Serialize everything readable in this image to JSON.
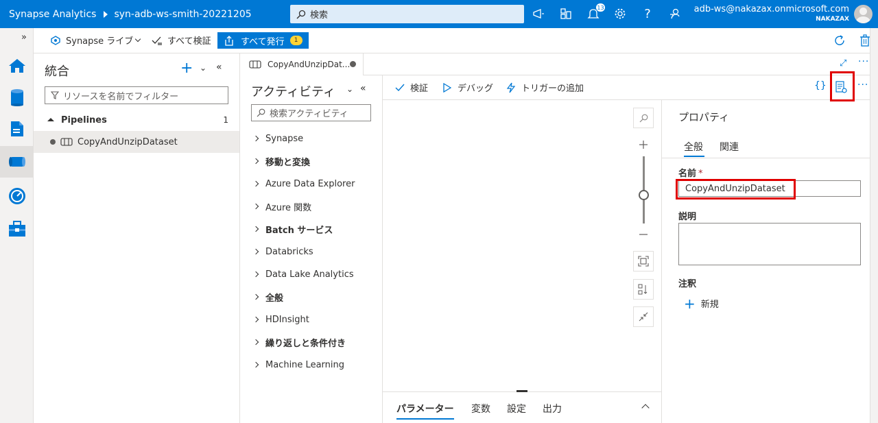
{
  "topbar": {
    "brand": "Synapse Analytics",
    "workspace": "syn-adb-ws-smith-20221205",
    "search_placeholder": "検索",
    "notification_count": "13",
    "user_email": "adb-ws@nakazax.onmicrosoft.com",
    "user_tenant": "NAKAZAX"
  },
  "rail": {
    "expand": "»",
    "items": [
      "home-icon",
      "data-icon",
      "develop-icon",
      "integrate-icon",
      "monitor-icon",
      "manage-icon"
    ]
  },
  "cmdbar": {
    "live_mode": "Synapse ライブ",
    "validate_all": "すべて検証",
    "publish_all": "すべて発行",
    "publish_badge": "1"
  },
  "resources": {
    "title": "統合",
    "filter_placeholder": "リソースを名前でフィルター",
    "group_label": "Pipelines",
    "group_count": "1",
    "item_label": "CopyAndUnzipDataset"
  },
  "tab": {
    "label": "CopyAndUnzipDat..."
  },
  "activities": {
    "title": "アクティビティ",
    "search_placeholder": "検索アクティビティ",
    "items": [
      {
        "label": "Synapse",
        "bold": false
      },
      {
        "label": "移動と変換",
        "bold": true
      },
      {
        "label": "Azure Data Explorer",
        "bold": false
      },
      {
        "label": "Azure 関数",
        "bold": false
      },
      {
        "label": "Batch サービス",
        "bold": true
      },
      {
        "label": "Databricks",
        "bold": false
      },
      {
        "label": "Data Lake Analytics",
        "bold": false
      },
      {
        "label": "全般",
        "bold": true
      },
      {
        "label": "HDInsight",
        "bold": false
      },
      {
        "label": "繰り返しと条件付き",
        "bold": true
      },
      {
        "label": "Machine Learning",
        "bold": false
      }
    ]
  },
  "pipeline_toolbar": {
    "validate": "検証",
    "debug": "デバッグ",
    "add_trigger": "トリガーの追加",
    "code": "{}"
  },
  "bottom_tabs": [
    "パラメーター",
    "変数",
    "設定",
    "出力"
  ],
  "properties": {
    "title": "プロパティ",
    "tab_general": "全般",
    "tab_related": "関連",
    "name_label": "名前",
    "required_mark": "*",
    "name_value": "CopyAndUnzipDataset",
    "description_label": "説明",
    "annotations_label": "注釈",
    "new_label": "新規"
  },
  "colors": {
    "accent": "#0078d4",
    "highlight": "#e00000",
    "badge": "#ffd335"
  }
}
